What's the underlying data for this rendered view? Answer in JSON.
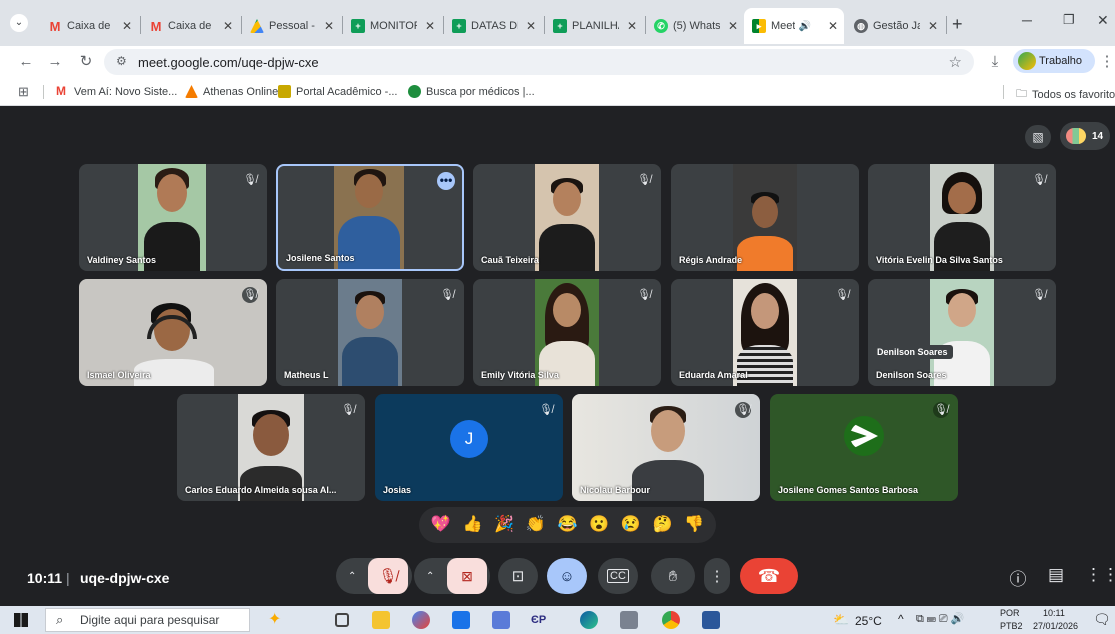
{
  "browser": {
    "tabs": [
      {
        "title": "Caixa de",
        "favicon": "gmail-icon",
        "color": "#ea4335"
      },
      {
        "title": "Caixa de",
        "favicon": "gmail-icon",
        "color": "#ea4335"
      },
      {
        "title": "Pessoal -",
        "favicon": "drive-icon",
        "color": "#fbbc04"
      },
      {
        "title": "MONITOR",
        "favicon": "sheets-icon",
        "color": "#0f9d58"
      },
      {
        "title": "DATAS DE",
        "favicon": "sheets-icon",
        "color": "#0f9d58"
      },
      {
        "title": "PLANILHA",
        "favicon": "sheets-icon",
        "color": "#0f9d58"
      },
      {
        "title": "(5) Whats",
        "favicon": "whatsapp-icon",
        "color": "#25d366"
      },
      {
        "title": "Meet",
        "favicon": "meet-icon",
        "color": "#00832d",
        "active": true
      },
      {
        "title": "Gestão Ja",
        "favicon": "globe-icon",
        "color": "#5f6368"
      }
    ],
    "url": "meet.google.com/uqe-dpjw-cxe",
    "profile_label": "Trabalho",
    "bookmarks": [
      {
        "label": "Vem Aí: Novo Siste...",
        "color": "#ea4335"
      },
      {
        "label": "Athenas Online",
        "color": "#f57c00"
      },
      {
        "label": "Portal Acadêmico -...",
        "color": "#c8a800"
      },
      {
        "label": "Busca por médicos |...",
        "color": "#1e8e3e"
      }
    ],
    "all_bookmarks_label": "Todos os favoritos"
  },
  "meet": {
    "participant_count": "14",
    "participants": [
      {
        "name": "Valdiney Santos"
      },
      {
        "name": "Josilene Santos"
      },
      {
        "name": "Cauã Teixeira"
      },
      {
        "name": "Régis Andrade"
      },
      {
        "name": "Vitória Evelin Da Silva Santos"
      },
      {
        "name": "Ismael Oliveira"
      },
      {
        "name": "Matheus L"
      },
      {
        "name": "Emily Vitória Silva"
      },
      {
        "name": "Eduarda Amaral"
      },
      {
        "name": "Denilson Soares",
        "tooltip": "Denilson Soares"
      },
      {
        "name": "Carlos Eduardo Almeida sousa Al..."
      },
      {
        "name": "Josias",
        "avatar_letter": "J"
      },
      {
        "name": "Nicolau Barbour"
      },
      {
        "name": "Josilene Gomes Santos Barbosa"
      }
    ],
    "reactions": [
      "💖",
      "👍",
      "🎉",
      "👏",
      "😂",
      "😮",
      "😢",
      "🤔",
      "👎"
    ],
    "clock": "10:11",
    "separator": "|",
    "meeting_code": "uqe-dpjw-cxe"
  },
  "taskbar": {
    "search_placeholder": "Digite aqui para pesquisar",
    "temperature": "25°C",
    "lang_top": "POR",
    "lang_bottom": "PTB2",
    "time": "10:11",
    "date": "27/01/2026"
  }
}
